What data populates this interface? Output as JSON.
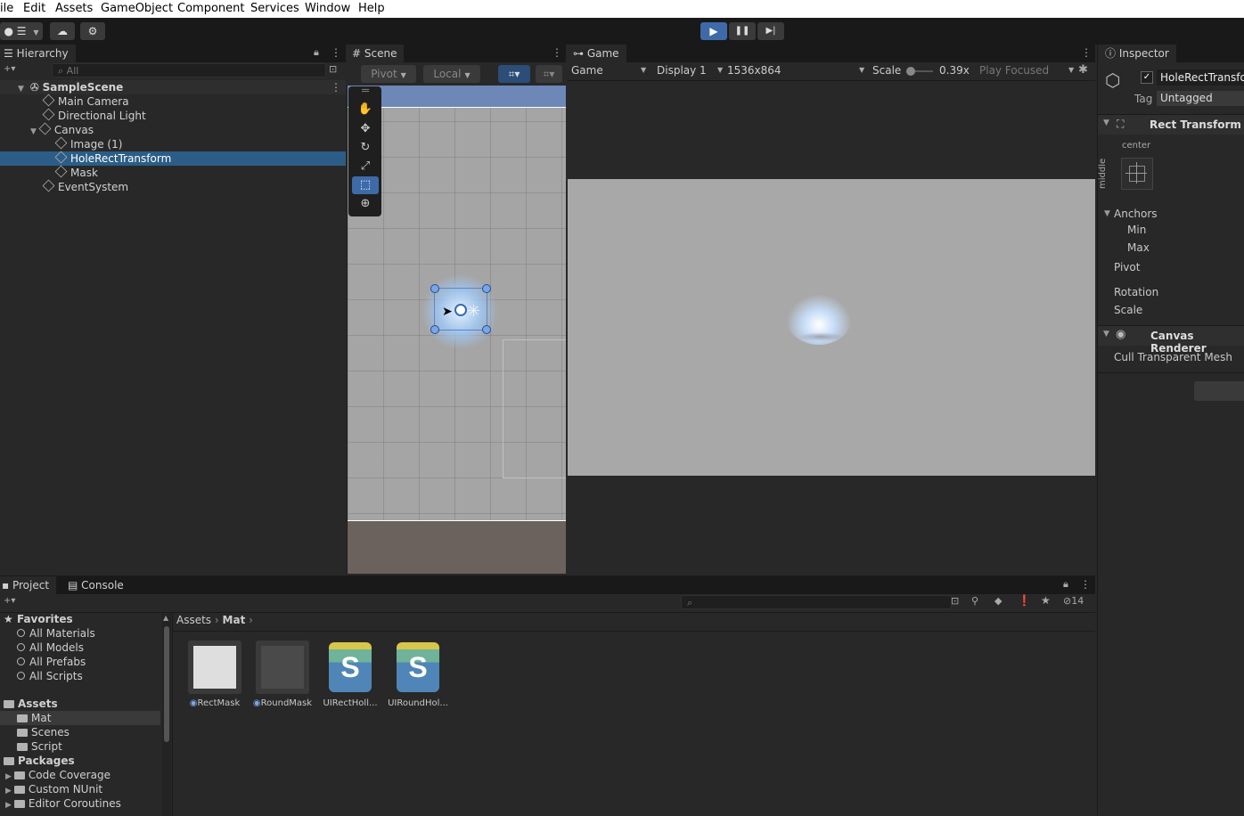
{
  "menu": [
    "ile",
    "Edit",
    "Assets",
    "GameObject",
    "Component",
    "Services",
    "Window",
    "Help"
  ],
  "toolbar": {
    "account_label": "●",
    "layers_label": "☰",
    "cloud_label": "☁",
    "collab_label": "⚙",
    "play_icon": "▶",
    "pause_icon": "❚❚",
    "step_icon": "▶|"
  },
  "hierarchy": {
    "tab": "Hierarchy",
    "search_placeholder": "All",
    "scene_name": "SampleScene",
    "items": [
      "Main Camera",
      "Directional Light",
      "Canvas",
      "Image (1)",
      "HoleRectTransform",
      "Mask",
      "EventSystem"
    ]
  },
  "scene": {
    "tab": "Scene",
    "pivot": "Pivot",
    "local": "Local"
  },
  "game": {
    "tab": "Game",
    "mode": "Game",
    "display": "Display 1",
    "resolution": "1536x864",
    "scale_label": "Scale",
    "scale_value": "0.39x",
    "play_focused": "Play Focused"
  },
  "inspector": {
    "tab": "Inspector",
    "object_name": "HoleRectTransfo",
    "tag_label": "Tag",
    "tag_value": "Untagged",
    "rect_transform": "Rect Transform",
    "anchor_h": "center",
    "anchor_v": "middle",
    "anchors": "Anchors",
    "min": "Min",
    "max": "Max",
    "pivot": "Pivot",
    "rotation": "Rotation",
    "scale": "Scale",
    "canvas_renderer": "Canvas Renderer",
    "cull": "Cull Transparent Mesh"
  },
  "project": {
    "tab_project": "Project",
    "tab_console": "Console",
    "hidden_count": "14",
    "breadcrumb": [
      "Assets",
      "Mat"
    ],
    "favorites_label": "Favorites",
    "favorites": [
      "All Materials",
      "All Models",
      "All Prefabs",
      "All Scripts"
    ],
    "assets_label": "Assets",
    "asset_folders": [
      "Mat",
      "Scenes",
      "Script"
    ],
    "packages_label": "Packages",
    "packages": [
      "Code Coverage",
      "Custom NUnit",
      "Editor Coroutines"
    ],
    "assets": [
      {
        "name": "RectMask",
        "kind": "material-white"
      },
      {
        "name": "RoundMask",
        "kind": "material-dark"
      },
      {
        "name": "UIRectHoll...",
        "kind": "shader"
      },
      {
        "name": "UIRoundHol...",
        "kind": "shader"
      }
    ],
    "shader_letter": "S"
  },
  "colors": {
    "accent": "#3e6aa8",
    "selection": "#2c5d87",
    "panel": "#282828"
  }
}
